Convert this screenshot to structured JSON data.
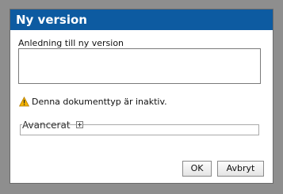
{
  "dialog": {
    "title": "Ny version",
    "reason_label": "Anledning till ny version",
    "reason_value": "",
    "warning_text": "Denna dokumenttyp är inaktiv.",
    "warning_icon": "warning-triangle-icon",
    "advanced_label": "Avancerat",
    "advanced_icon": "expand-plus-icon",
    "ok_label": "OK",
    "cancel_label": "Avbryt"
  },
  "colors": {
    "titlebar": "#0d5ba1",
    "backdrop": "#8e8e8e",
    "warning": "#f5b400"
  }
}
